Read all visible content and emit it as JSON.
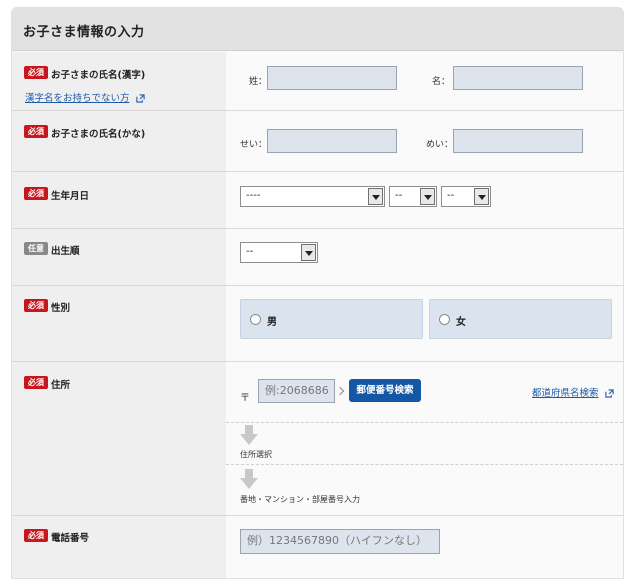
{
  "section_title": "お子さま情報の入力",
  "badges": {
    "required": "必須",
    "optional": "任意"
  },
  "rows": {
    "name_kanji": {
      "label": "お子さまの氏名(漢字)",
      "link": "漢字名をお持ちでない方",
      "last_label": "姓：",
      "first_label": "名：",
      "last_value": "",
      "first_value": ""
    },
    "name_kana": {
      "label": "お子さまの氏名(かな)",
      "last_label": "せい：",
      "first_label": "めい：",
      "last_value": "",
      "first_value": ""
    },
    "birthdate": {
      "label": "生年月日",
      "year": "----",
      "month": "--",
      "day": "--"
    },
    "birth_order": {
      "label": "出生順",
      "value": "--"
    },
    "gender": {
      "label": "性別",
      "male": "男",
      "female": "女"
    },
    "address": {
      "label": "住所",
      "postal_mark": "〒",
      "postal_placeholder": "例:2068686",
      "search_button": "郵便番号検索",
      "prefecture_link": "都道府県名検索",
      "step1": "住所選択",
      "step2": "番地・マンション・部屋番号入力"
    },
    "phone": {
      "label": "電話番号",
      "placeholder": "例）1234567890（ハイフンなし）"
    }
  }
}
